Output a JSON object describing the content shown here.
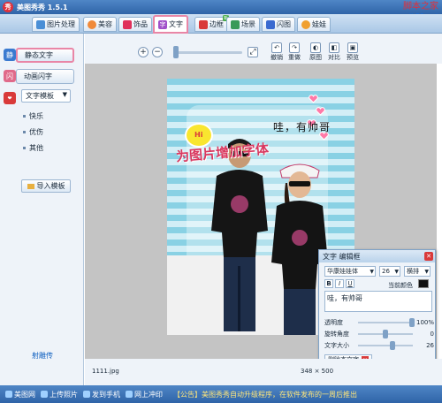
{
  "app": {
    "title": "美图秀秀 1.5.1",
    "logo_icon": "app-logo-icon"
  },
  "watermark": {
    "line1": "脚本之家",
    "line2": "www.Jb51.net"
  },
  "nav": {
    "tabs": [
      {
        "label": "图片处理",
        "icon": "picture-icon"
      },
      {
        "label": "美容",
        "icon": "smile-icon"
      },
      {
        "label": "饰品",
        "icon": "heart-icon"
      },
      {
        "label": "文字",
        "icon": "text-icon",
        "active": true
      },
      {
        "label": "边框",
        "icon": "frame-icon",
        "badge": "新"
      },
      {
        "label": "场景",
        "icon": "scene-icon"
      },
      {
        "label": "闪图",
        "icon": "flash-icon"
      },
      {
        "label": "娃娃",
        "icon": "doll-icon"
      }
    ]
  },
  "left": {
    "static_text": "静态文字",
    "animated_text": "动画闪字",
    "template_select": "文字模板",
    "template_items": [
      "快乐",
      "优伤",
      "其他"
    ],
    "import_label": "导入模板",
    "author_link": "射雕传"
  },
  "toolbar": {
    "undo": "撤销",
    "redo": "重做",
    "original": "原图",
    "compare": "对比",
    "preview": "预览"
  },
  "canvas": {
    "photo_text": "哇，有帅哥",
    "overlay_caption": "为图片增加字体",
    "bubble_text": "Hi"
  },
  "edit_panel": {
    "title": "文字 编辑框",
    "font": "华康娃娃体",
    "size": "26",
    "orientation": "横排",
    "current_color_label": "当前颜色",
    "text_value": "哇，有帅哥",
    "transparency_label": "透明度",
    "transparency_value": "100%",
    "rotation_label": "旋转角度",
    "rotation_value": "0",
    "font_size_label": "文字大小",
    "font_size_value": "26",
    "delete_label": "删除本文字"
  },
  "status": {
    "filename": "1111.jpg",
    "dimensions": "348 × 500"
  },
  "bottom": {
    "items": [
      "美图网",
      "上传照片",
      "发到手机",
      "网上冲印"
    ],
    "news": "【公告】美图秀秀自动升级程序，在软件发布的一周后推出"
  },
  "colors": {
    "active_tab_border": "#e986a6",
    "title_bar": "#2f64a8",
    "overlay_caption": "#d9385f"
  }
}
